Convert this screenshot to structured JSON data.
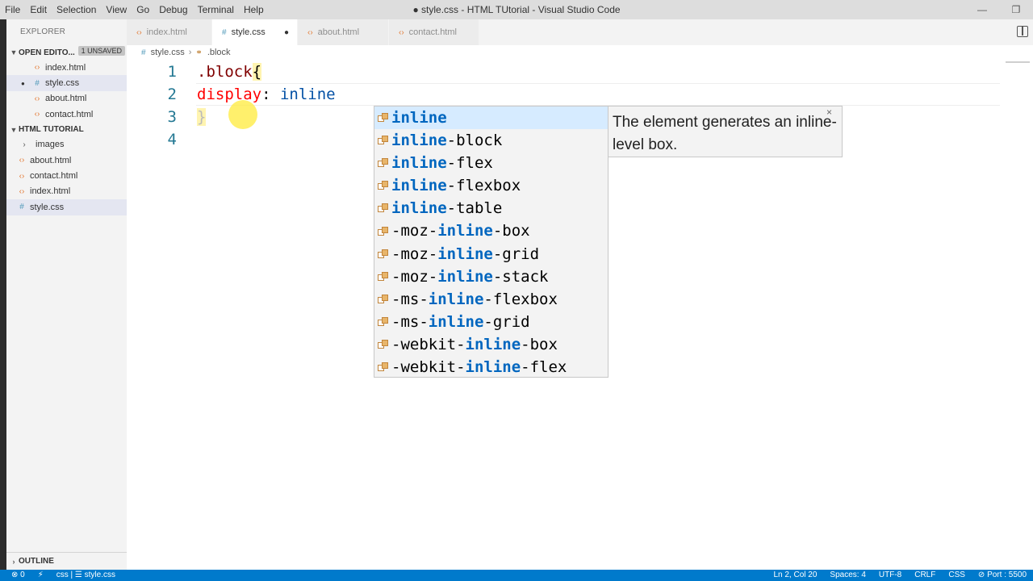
{
  "titlebar": {
    "menu": [
      "File",
      "Edit",
      "Selection",
      "View",
      "Go",
      "Debug",
      "Terminal",
      "Help"
    ],
    "title": "● style.css - HTML TUtorial - Visual Studio Code",
    "minimize": "—",
    "maximize": "❐"
  },
  "sidebar": {
    "title": "EXPLORER",
    "open_editors": {
      "label": "OPEN EDITO...",
      "badge": "1 UNSAVED",
      "items": [
        {
          "label": "index.html",
          "type": "html"
        },
        {
          "label": "style.css",
          "type": "css",
          "dirty": "●"
        },
        {
          "label": "about.html",
          "type": "html"
        },
        {
          "label": "contact.html",
          "type": "html"
        }
      ]
    },
    "project": {
      "label": "HTML TUTORIAL",
      "items": [
        {
          "label": "images",
          "type": "folder"
        },
        {
          "label": "about.html",
          "type": "html"
        },
        {
          "label": "contact.html",
          "type": "html"
        },
        {
          "label": "index.html",
          "type": "html"
        },
        {
          "label": "style.css",
          "type": "css"
        }
      ]
    },
    "outline_label": "OUTLINE"
  },
  "tabs": [
    {
      "label": "index.html",
      "type": "html"
    },
    {
      "label": "style.css",
      "type": "css",
      "dirty": "●"
    },
    {
      "label": "about.html",
      "type": "html"
    },
    {
      "label": "contact.html",
      "type": "html"
    }
  ],
  "breadcrumb": {
    "file": "style.css",
    "symbol": ".block"
  },
  "editor": {
    "line_numbers": [
      "1",
      "2",
      "3",
      "4"
    ],
    "line1": {
      "selector": ".block",
      "brace": "{"
    },
    "line2": {
      "indent": "    ",
      "property": "display",
      "colon": ": ",
      "value": "inline"
    },
    "line3": {
      "brace": "}"
    }
  },
  "suggest": {
    "items": [
      {
        "pre": "",
        "match": "inline",
        "post": ""
      },
      {
        "pre": "",
        "match": "inline",
        "post": "-block"
      },
      {
        "pre": "",
        "match": "inline",
        "post": "-flex"
      },
      {
        "pre": "",
        "match": "inline",
        "post": "-flexbox"
      },
      {
        "pre": "",
        "match": "inline",
        "post": "-table"
      },
      {
        "pre": "-moz-",
        "match": "inline",
        "post": "-box"
      },
      {
        "pre": "-moz-",
        "match": "inline",
        "post": "-grid"
      },
      {
        "pre": "-moz-",
        "match": "inline",
        "post": "-stack"
      },
      {
        "pre": "-ms-",
        "match": "inline",
        "post": "-flexbox"
      },
      {
        "pre": "-ms-",
        "match": "inline",
        "post": "-grid"
      },
      {
        "pre": "-webkit-",
        "match": "inline",
        "post": "-box"
      },
      {
        "pre": "-webkit-",
        "match": "inline",
        "post": "-flex"
      }
    ],
    "details": "The element generates an inline-level box.",
    "close": "×"
  },
  "statusbar": {
    "errors": "⊗ 0",
    "branch_icon": "⚡",
    "lang_info": "css | ☰ style.css",
    "position": "Ln 2, Col 20",
    "spaces": "Spaces: 4",
    "encoding": "UTF-8",
    "eol": "CRLF",
    "language": "CSS",
    "port": "⊘ Port : 5500"
  },
  "colors": {
    "accent": "#007acc",
    "selector": "#800000",
    "property": "#ff0000",
    "value": "#0451a5",
    "match": "#0066bf"
  }
}
